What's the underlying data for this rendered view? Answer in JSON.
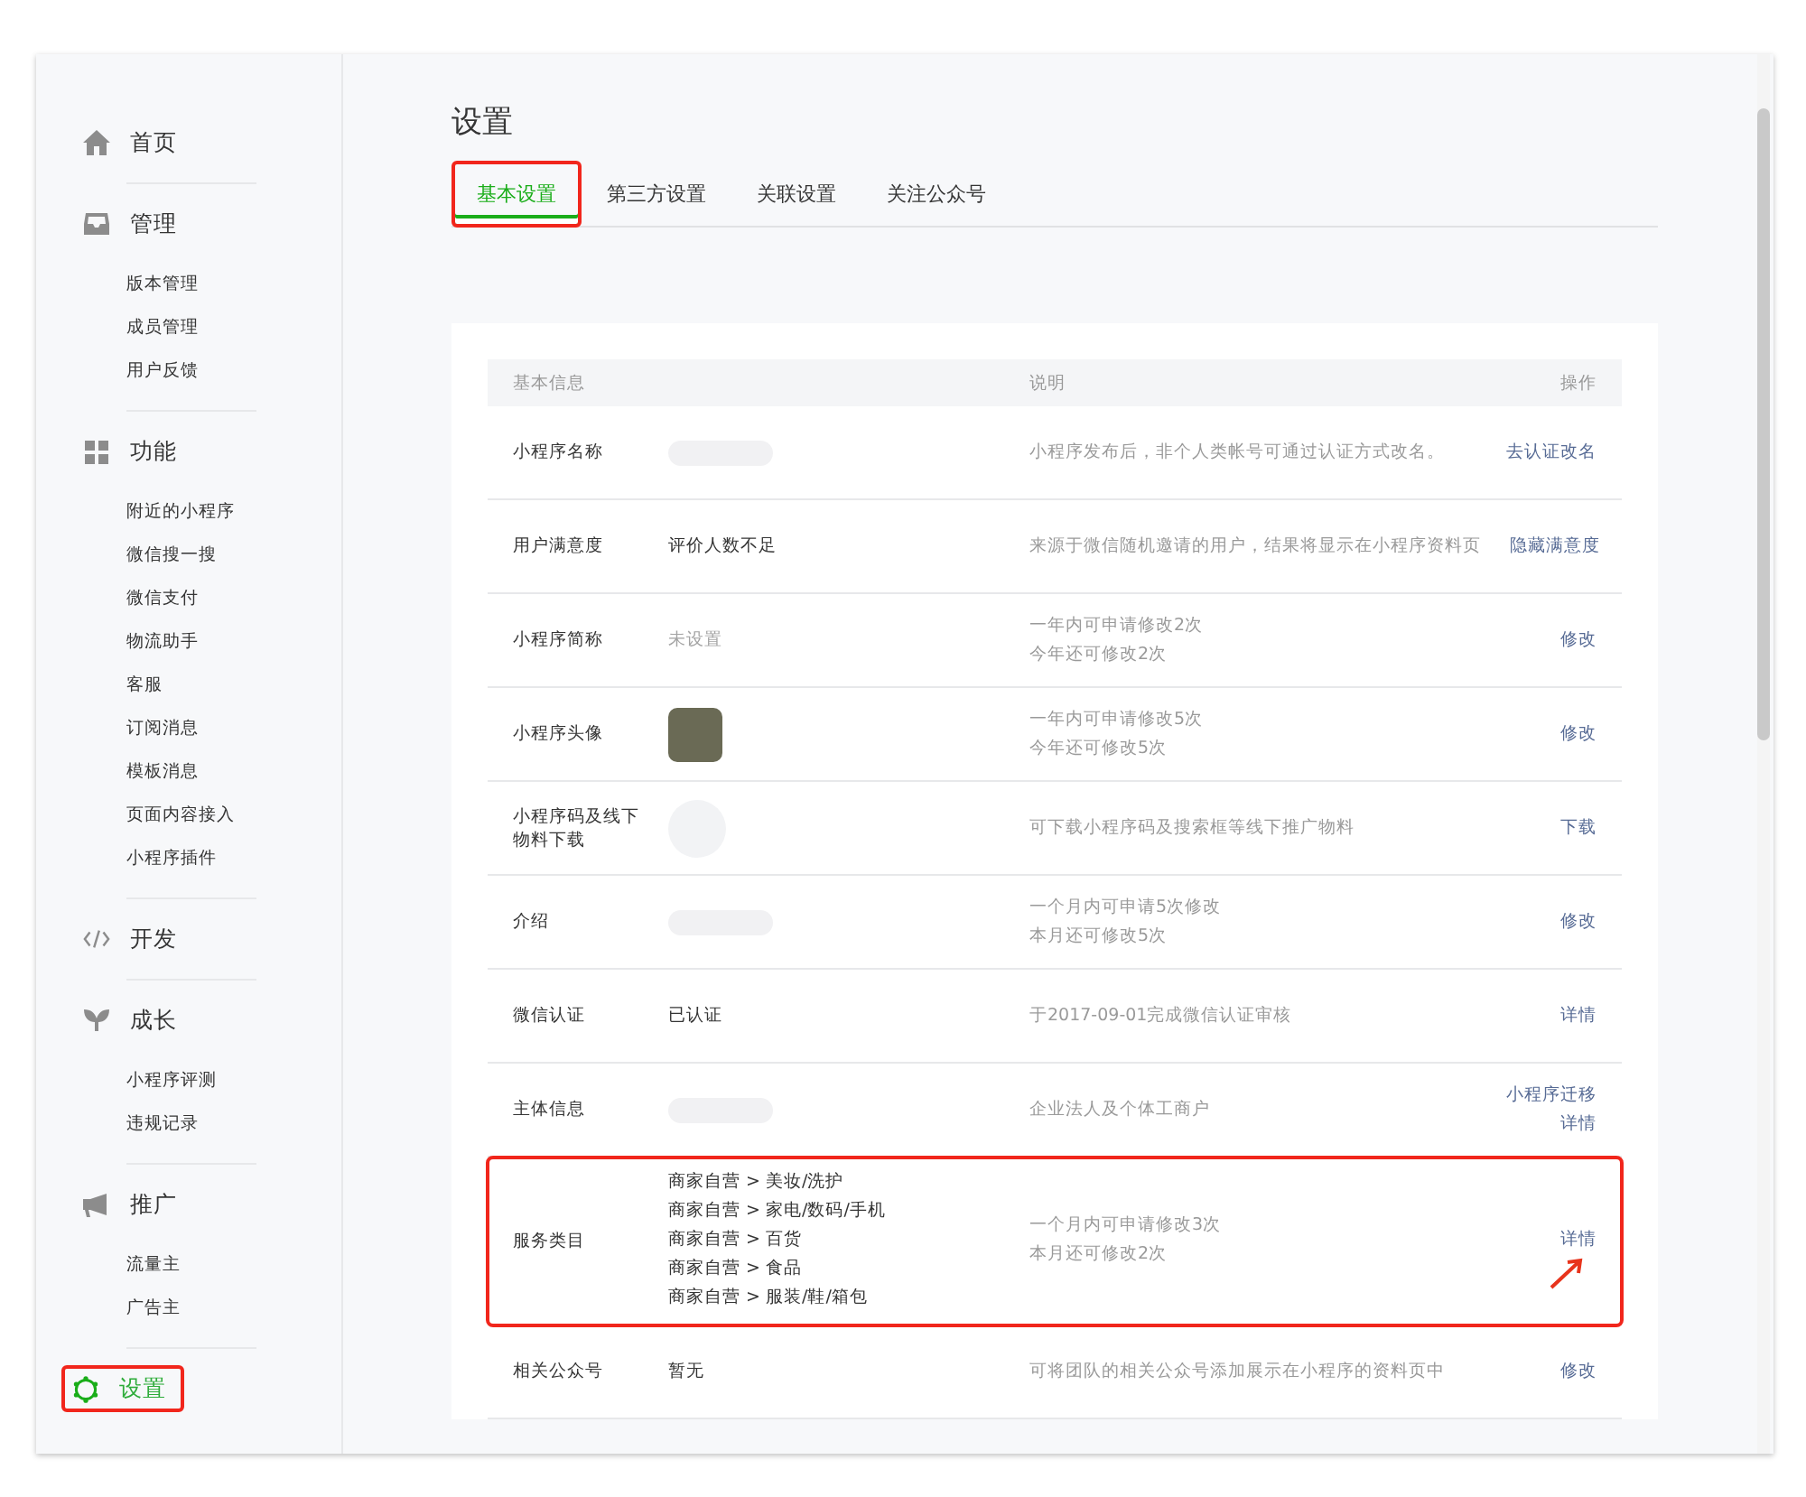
{
  "sidebar": {
    "groups": [
      {
        "label": "首页",
        "selected": false,
        "highlighted": false
      },
      {
        "label": "管理",
        "selected": false,
        "highlighted": false,
        "items": [
          "版本管理",
          "成员管理",
          "用户反馈"
        ]
      },
      {
        "label": "功能",
        "selected": false,
        "highlighted": false,
        "items": [
          "附近的小程序",
          "微信搜一搜",
          "微信支付",
          "物流助手",
          "客服",
          "订阅消息",
          "模板消息",
          "页面内容接入",
          "小程序插件"
        ]
      },
      {
        "label": "开发",
        "selected": false,
        "highlighted": false
      },
      {
        "label": "成长",
        "selected": false,
        "highlighted": false,
        "items": [
          "小程序评测",
          "违规记录"
        ]
      },
      {
        "label": "推广",
        "selected": false,
        "highlighted": false,
        "items": [
          "流量主",
          "广告主"
        ]
      },
      {
        "label": "设置",
        "selected": true,
        "highlighted": true
      }
    ]
  },
  "page_title": "设置",
  "tabs": [
    {
      "label": "基本设置",
      "selected": true,
      "highlighted": true
    },
    {
      "label": "第三方设置",
      "selected": false,
      "highlighted": false
    },
    {
      "label": "关联设置",
      "selected": false,
      "highlighted": false
    },
    {
      "label": "关注公众号",
      "selected": false,
      "highlighted": false
    }
  ],
  "table": {
    "columns": [
      "基本信息",
      "说明",
      "操作"
    ],
    "rows": [
      {
        "label": "小程序名称",
        "kind": "redacted",
        "description": [
          "小程序发布后，非个人类帐号可通过认证方式改名。"
        ],
        "actions": [
          "去认证改名"
        ],
        "highlighted": false
      },
      {
        "label": "用户满意度",
        "kind": "text",
        "value": [
          "评价人数不足"
        ],
        "description": [
          "来源于微信随机邀请的用户，结果将显示在小程序资料页"
        ],
        "actions": [
          "隐藏满意度"
        ],
        "highlighted": false
      },
      {
        "label": "小程序简称",
        "kind": "muted",
        "value": [
          "未设置"
        ],
        "description": [
          "一年内可申请修改2次",
          "今年还可修改2次"
        ],
        "actions": [
          "修改"
        ],
        "highlighted": false
      },
      {
        "label": "小程序头像",
        "kind": "avatar",
        "description": [
          "一年内可申请修改5次",
          "今年还可修改5次"
        ],
        "actions": [
          "修改"
        ],
        "highlighted": false
      },
      {
        "label": "小程序码及线下物料下载",
        "kind": "qr",
        "description": [
          "可下载小程序码及搜索框等线下推广物料"
        ],
        "actions": [
          "下载"
        ],
        "highlighted": false
      },
      {
        "label": "介绍",
        "kind": "redacted",
        "description": [
          "一个月内可申请5次修改",
          "本月还可修改5次"
        ],
        "actions": [
          "修改"
        ],
        "highlighted": false
      },
      {
        "label": "微信认证",
        "kind": "text",
        "value": [
          "已认证"
        ],
        "description": [
          "于2017-09-01完成微信认证审核"
        ],
        "actions": [
          "详情"
        ],
        "highlighted": false
      },
      {
        "label": "主体信息",
        "kind": "redacted",
        "description": [
          "企业法人及个体工商户"
        ],
        "actions": [
          "小程序迁移",
          "详情"
        ],
        "highlighted": false
      },
      {
        "label": "服务类目",
        "kind": "text",
        "value": [
          "商家自营 > 美妆/洗护",
          "商家自营 > 家电/数码/手机",
          "商家自营 > 百货",
          "商家自营 > 食品",
          "商家自营 > 服装/鞋/箱包"
        ],
        "description": [
          "一个月内可申请修改3次",
          "本月还可修改2次"
        ],
        "actions": [
          "详情"
        ],
        "highlighted": true
      },
      {
        "label": "相关公众号",
        "kind": "text",
        "value": [
          "暂无"
        ],
        "description": [
          "可将团队的相关公众号添加展示在小程序的资料页中"
        ],
        "actions": [
          "修改"
        ],
        "highlighted": false
      }
    ]
  }
}
